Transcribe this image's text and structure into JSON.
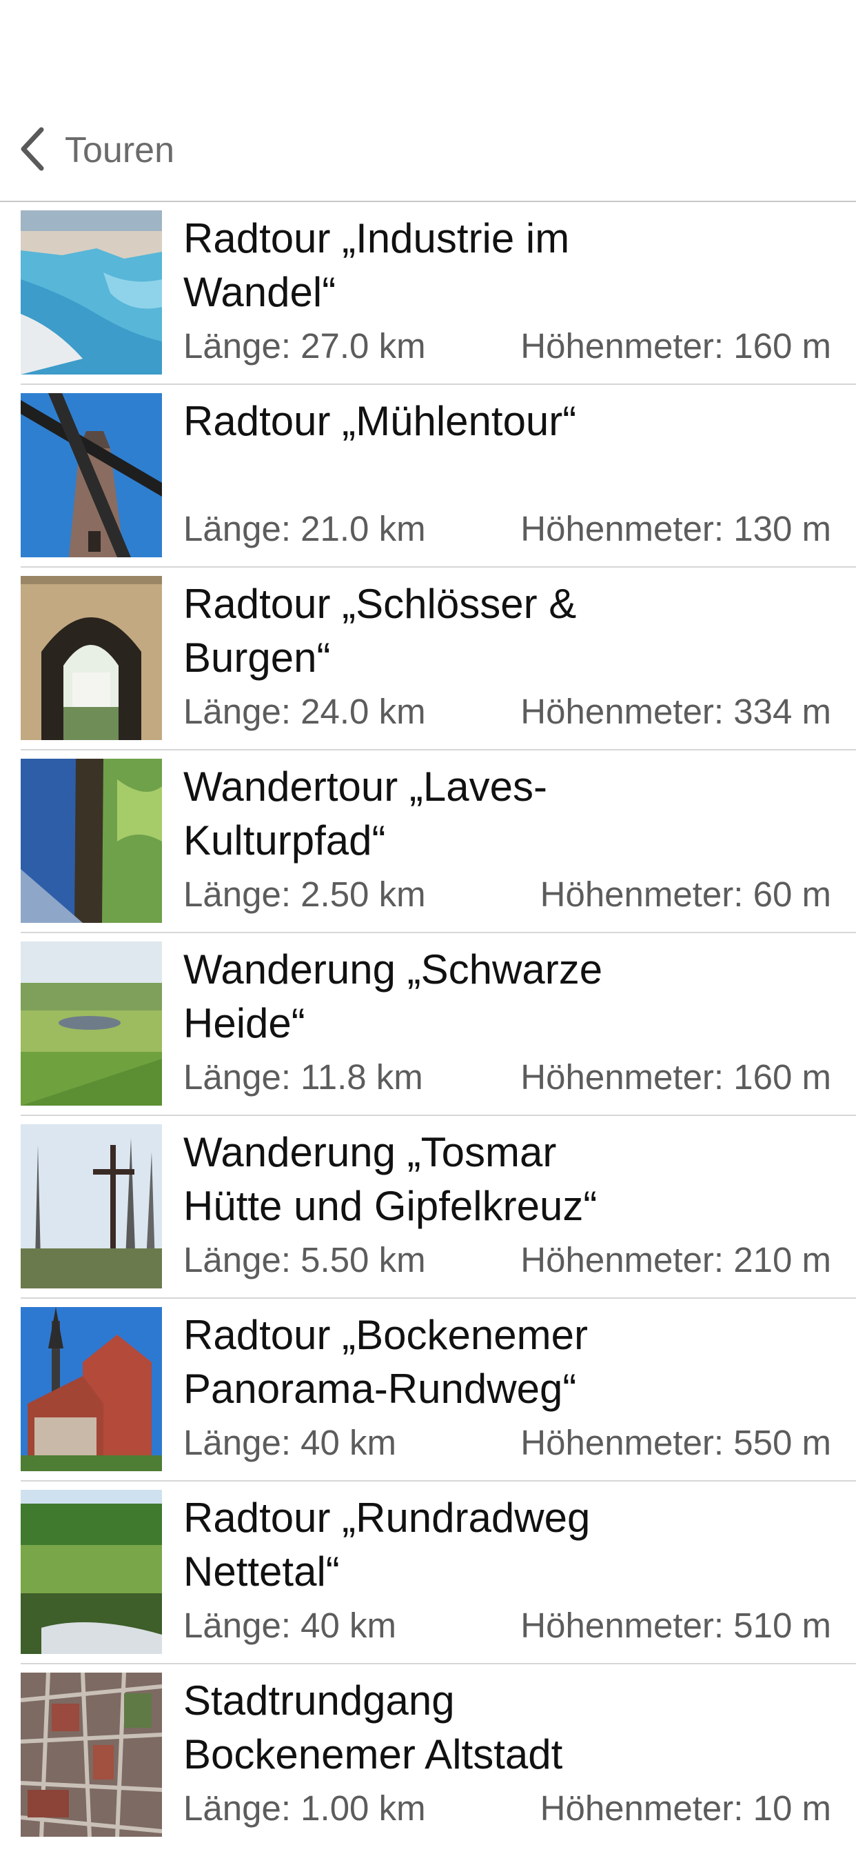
{
  "nav": {
    "back_label": "Touren",
    "back_icon": "chevron-left-icon"
  },
  "tours": [
    {
      "title": "Radtour „Industrie im Wandel“",
      "length": "Länge: 27.0 km",
      "elevation": "Höhenmeter: 160 m"
    },
    {
      "title": "Radtour „Mühlentour“",
      "length": "Länge: 21.0 km",
      "elevation": "Höhenmeter: 130 m"
    },
    {
      "title": "Radtour „Schlösser & Burgen“",
      "length": "Länge: 24.0 km",
      "elevation": "Höhenmeter: 334 m"
    },
    {
      "title": "Wandertour „Laves-Kulturpfad“",
      "length": "Länge: 2.50 km",
      "elevation": "Höhenmeter: 60 m"
    },
    {
      "title": "Wanderung „Schwarze Heide“",
      "length": "Länge: 11.8 km",
      "elevation": "Höhenmeter: 160 m"
    },
    {
      "title": "Wanderung „Tosmar Hütte und Gipfelkreuz“",
      "length": "Länge: 5.50 km",
      "elevation": "Höhenmeter: 210 m"
    },
    {
      "title": "Radtour „Bockenemer Panorama-Rundweg“",
      "length": "Länge: 40 km",
      "elevation": "Höhenmeter: 550 m"
    },
    {
      "title": "Radtour „Rundradweg Nettetal“",
      "length": "Länge: 40 km",
      "elevation": "Höhenmeter: 510 m"
    },
    {
      "title": "Stadtrundgang Bockenemer Altstadt",
      "length": "Länge: 1.00 km",
      "elevation": "Höhenmeter: 10 m"
    }
  ]
}
